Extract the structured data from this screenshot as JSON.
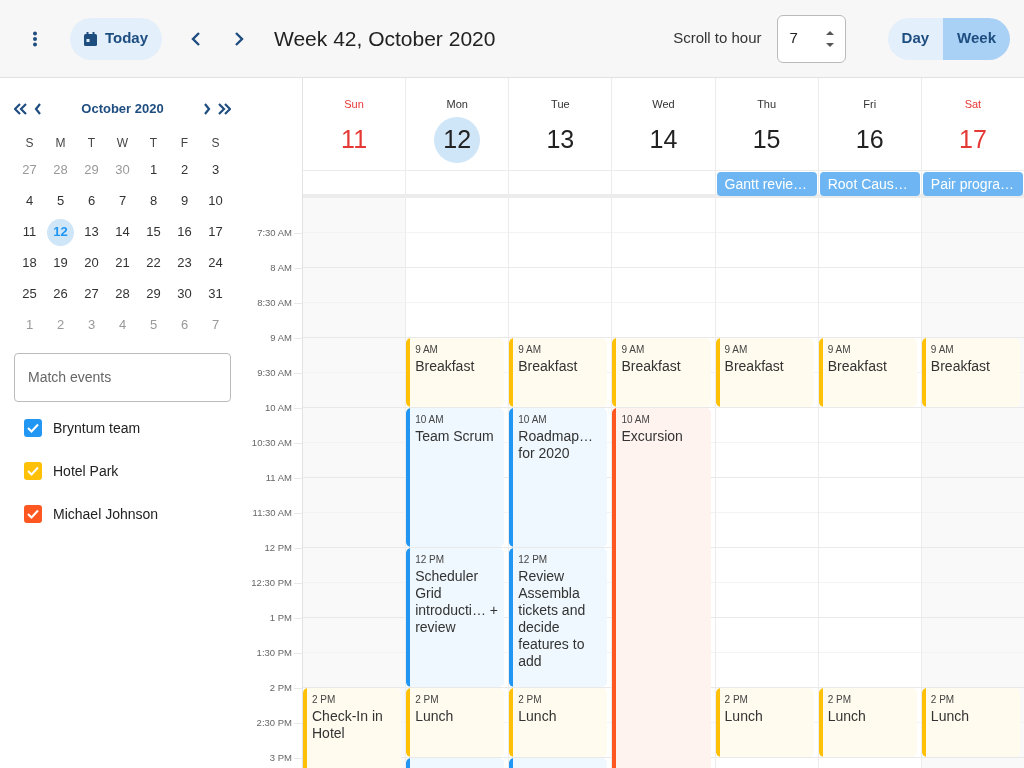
{
  "toolbar": {
    "today": "Today",
    "title": "Week 42, October 2020",
    "scroll_label": "Scroll to hour",
    "scroll_value": "7",
    "modes": [
      {
        "label": "Day",
        "selected": false
      },
      {
        "label": "Week",
        "selected": true
      }
    ]
  },
  "mini_calendar": {
    "month": "October 2020",
    "weekdays": [
      "S",
      "M",
      "T",
      "W",
      "T",
      "F",
      "S"
    ],
    "days": [
      {
        "label": "27",
        "other_month": true,
        "selected": false
      },
      {
        "label": "28",
        "other_month": true,
        "selected": false
      },
      {
        "label": "29",
        "other_month": true,
        "selected": false
      },
      {
        "label": "30",
        "other_month": true,
        "selected": false
      },
      {
        "label": "1",
        "other_month": false,
        "selected": false
      },
      {
        "label": "2",
        "other_month": false,
        "selected": false
      },
      {
        "label": "3",
        "other_month": false,
        "selected": false
      },
      {
        "label": "4",
        "other_month": false,
        "selected": false
      },
      {
        "label": "5",
        "other_month": false,
        "selected": false
      },
      {
        "label": "6",
        "other_month": false,
        "selected": false
      },
      {
        "label": "7",
        "other_month": false,
        "selected": false
      },
      {
        "label": "8",
        "other_month": false,
        "selected": false
      },
      {
        "label": "9",
        "other_month": false,
        "selected": false
      },
      {
        "label": "10",
        "other_month": false,
        "selected": false
      },
      {
        "label": "11",
        "other_month": false,
        "selected": false
      },
      {
        "label": "12",
        "other_month": false,
        "selected": true
      },
      {
        "label": "13",
        "other_month": false,
        "selected": false
      },
      {
        "label": "14",
        "other_month": false,
        "selected": false
      },
      {
        "label": "15",
        "other_month": false,
        "selected": false
      },
      {
        "label": "16",
        "other_month": false,
        "selected": false
      },
      {
        "label": "17",
        "other_month": false,
        "selected": false
      },
      {
        "label": "18",
        "other_month": false,
        "selected": false
      },
      {
        "label": "19",
        "other_month": false,
        "selected": false
      },
      {
        "label": "20",
        "other_month": false,
        "selected": false
      },
      {
        "label": "21",
        "other_month": false,
        "selected": false
      },
      {
        "label": "22",
        "other_month": false,
        "selected": false
      },
      {
        "label": "23",
        "other_month": false,
        "selected": false
      },
      {
        "label": "24",
        "other_month": false,
        "selected": false
      },
      {
        "label": "25",
        "other_month": false,
        "selected": false
      },
      {
        "label": "26",
        "other_month": false,
        "selected": false
      },
      {
        "label": "27",
        "other_month": false,
        "selected": false
      },
      {
        "label": "28",
        "other_month": false,
        "selected": false
      },
      {
        "label": "29",
        "other_month": false,
        "selected": false
      },
      {
        "label": "30",
        "other_month": false,
        "selected": false
      },
      {
        "label": "31",
        "other_month": false,
        "selected": false
      },
      {
        "label": "1",
        "other_month": true,
        "selected": false
      },
      {
        "label": "2",
        "other_month": true,
        "selected": false
      },
      {
        "label": "3",
        "other_month": true,
        "selected": false
      },
      {
        "label": "4",
        "other_month": true,
        "selected": false
      },
      {
        "label": "5",
        "other_month": true,
        "selected": false
      },
      {
        "label": "6",
        "other_month": true,
        "selected": false
      },
      {
        "label": "7",
        "other_month": true,
        "selected": false
      }
    ]
  },
  "filter": {
    "placeholder": "Match events"
  },
  "calendars": [
    {
      "name": "Bryntum team",
      "checked": true,
      "color": "#2196f3"
    },
    {
      "name": "Hotel Park",
      "checked": true,
      "color": "#ffc107"
    },
    {
      "name": "Michael Johnson",
      "checked": true,
      "color": "#ff5722"
    }
  ],
  "time_labels": [
    "7:30 AM",
    "8 AM",
    "8:30 AM",
    "9 AM",
    "9:30 AM",
    "10 AM",
    "10:30 AM",
    "11 AM",
    "11:30 AM",
    "12 PM",
    "12:30 PM",
    "1 PM",
    "1:30 PM",
    "2 PM",
    "2:30 PM",
    "3 PM"
  ],
  "days": [
    {
      "name": "Sun",
      "number": "11",
      "weekend": true,
      "selected": false,
      "events": [
        {
          "time": "2 PM",
          "title": "Check-In in Hotel",
          "color": "#ffc107"
        }
      ]
    },
    {
      "name": "Mon",
      "number": "12",
      "weekend": false,
      "selected": true,
      "events": [
        {
          "time": "9 AM",
          "title": "Breakfast",
          "color": "#ffc107"
        },
        {
          "time": "10 AM",
          "title": "Team Scrum",
          "color": "#2196f3"
        },
        {
          "time": "12 PM",
          "title": "Scheduler Grid introducti… + review",
          "color": "#2196f3"
        },
        {
          "time": "2 PM",
          "title": "Lunch",
          "color": "#ffc107"
        },
        {
          "color": "#2196f3"
        }
      ]
    },
    {
      "name": "Tue",
      "number": "13",
      "weekend": false,
      "selected": false,
      "events": [
        {
          "time": "9 AM",
          "title": "Breakfast",
          "color": "#ffc107"
        },
        {
          "time": "10 AM",
          "title": "Roadmap… for 2020",
          "color": "#2196f3"
        },
        {
          "time": "12 PM",
          "title": "Review Assembla tickets and decide features to add",
          "color": "#2196f3"
        },
        {
          "time": "2 PM",
          "title": "Lunch",
          "color": "#ffc107"
        },
        {
          "color": "#2196f3"
        }
      ]
    },
    {
      "name": "Wed",
      "number": "14",
      "weekend": false,
      "selected": false,
      "events": [
        {
          "time": "9 AM",
          "title": "Breakfast",
          "color": "#ffc107"
        },
        {
          "time": "10 AM",
          "title": "Excursion",
          "color": "#ff5722"
        }
      ]
    },
    {
      "name": "Thu",
      "number": "15",
      "weekend": false,
      "selected": false,
      "all_day": {
        "title": "Gantt revie…",
        "color": "#6db6f3"
      },
      "events": [
        {
          "time": "9 AM",
          "title": "Breakfast",
          "color": "#ffc107"
        },
        {
          "time": "2 PM",
          "title": "Lunch",
          "color": "#ffc107"
        }
      ]
    },
    {
      "name": "Fri",
      "number": "16",
      "weekend": false,
      "selected": false,
      "all_day": {
        "title": "Root Caus…",
        "color": "#6db6f3"
      },
      "events": [
        {
          "time": "9 AM",
          "title": "Breakfast",
          "color": "#ffc107"
        },
        {
          "time": "2 PM",
          "title": "Lunch",
          "color": "#ffc107"
        }
      ]
    },
    {
      "name": "Sat",
      "number": "17",
      "weekend": true,
      "selected": false,
      "all_day": {
        "title": "Pair progra…",
        "color": "#6db6f3"
      },
      "events": [
        {
          "time": "9 AM",
          "title": "Breakfast",
          "color": "#ffc107"
        },
        {
          "time": "2 PM",
          "title": "Lunch",
          "color": "#ffc107"
        }
      ]
    }
  ]
}
